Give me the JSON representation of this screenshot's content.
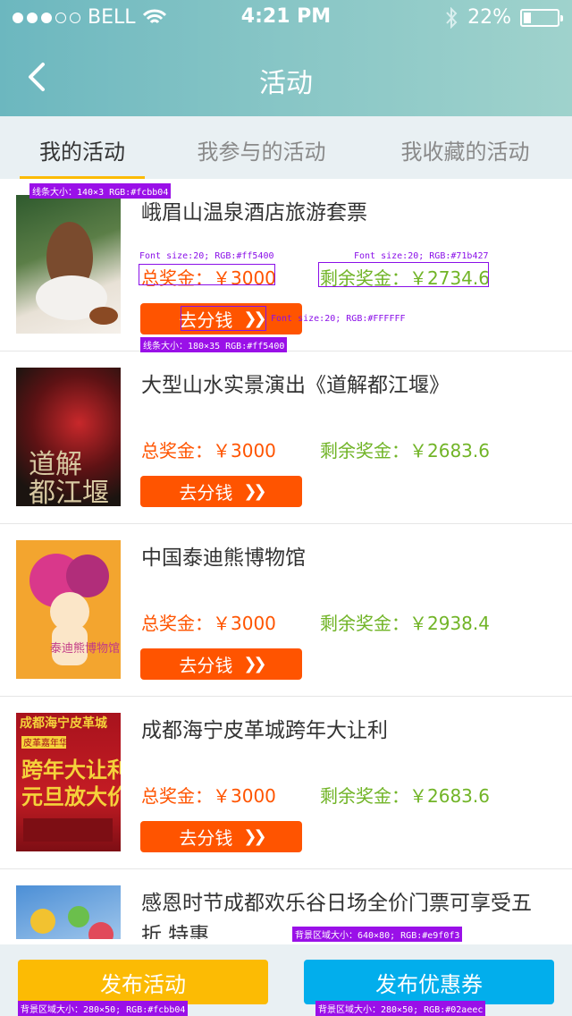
{
  "status_bar": {
    "carrier": "BELL",
    "time": "4:21 PM",
    "battery": "22%",
    "battery_level": 0.22
  },
  "nav": {
    "title": "活动",
    "back_icon": "chevron-left-icon"
  },
  "tabs": [
    {
      "label": "我的活动",
      "active": true
    },
    {
      "label": "我参与的活动",
      "active": false
    },
    {
      "label": "我收藏的活动",
      "active": false
    }
  ],
  "items": [
    {
      "title": "峨眉山温泉酒店旅游套票",
      "total": "总奖金：￥3000",
      "remain": "剩余奖金：￥2734.6",
      "button": "去分钱",
      "thumb_colors": [
        "#2f5a2e",
        "#e8e1d6"
      ]
    },
    {
      "title": "大型山水实景演出《道解都江堰》",
      "total": "总奖金：￥3000",
      "remain": "剩余奖金：￥2683.6",
      "button": "去分钱",
      "thumb_colors": [
        "#1b1410",
        "#c8282b"
      ]
    },
    {
      "title": "中国泰迪熊博物馆",
      "total": "总奖金：￥3000",
      "remain": "剩余奖金：￥2938.4",
      "button": "去分钱",
      "thumb_colors": [
        "#f3a52f",
        "#d9388b"
      ]
    },
    {
      "title": "成都海宁皮革城跨年大让利",
      "total": "总奖金：￥3000",
      "remain": "剩余奖金：￥2683.6",
      "button": "去分钱",
      "thumb_colors": [
        "#a8131d",
        "#f5d23b"
      ]
    },
    {
      "title": "感恩时节成都欢乐谷日场全价门票可享受五折 特惠",
      "total": "",
      "remain": "",
      "button": "",
      "thumb_colors": [
        "#4c8fd6",
        "#e14a5a"
      ]
    }
  ],
  "annotations": {
    "tab_line": "线条大小：140×3  RGB:#fcbb04",
    "total_font": "Font size:20; RGB:#ff5400",
    "remain_font": "Font size:20; RGB:#71b427",
    "button_font": "Font size:20; RGB:#FFFFFF",
    "button_size": "线条大小：180×35  RGB:#ff5400",
    "bottom_bg": "背景区域大小：640×80; RGB:#e9f0f3",
    "left_btn_bg": "背景区域大小：280×50; RGB:#fcbb04",
    "right_btn_bg": "背景区域大小：280×50; RGB:#02aeec"
  },
  "bottom": {
    "left_button": "发布活动",
    "right_button": "发布优惠券"
  },
  "colors": {
    "accent_yellow": "#fcbb04",
    "orange": "#ff5400",
    "green": "#71b427",
    "blue": "#02aeec",
    "bg_gray": "#e9f0f3"
  }
}
